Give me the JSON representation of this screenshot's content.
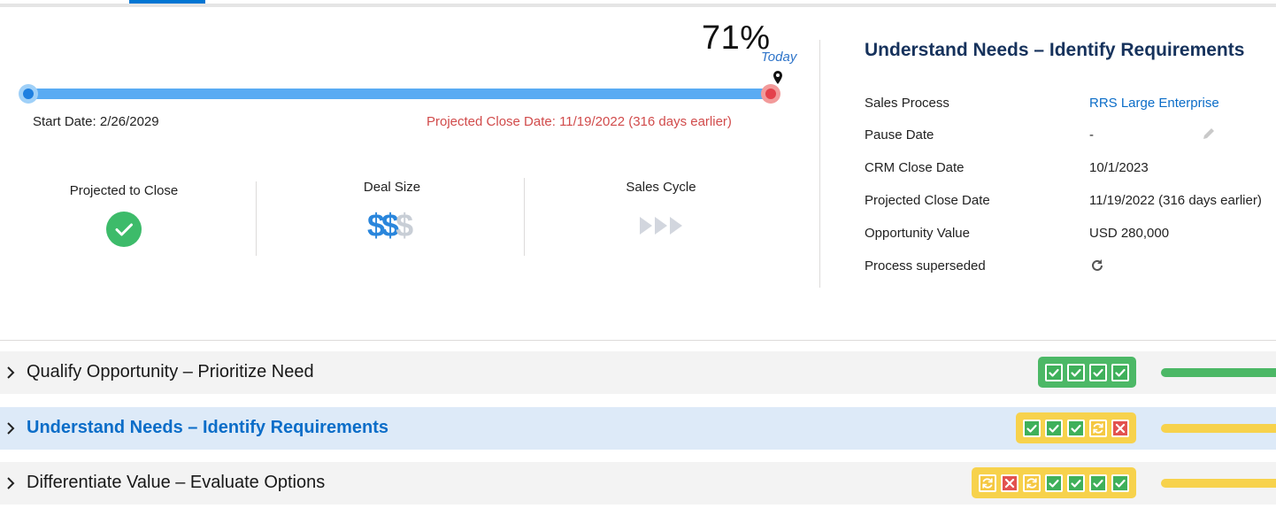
{
  "progress": {
    "percent": "71%",
    "percent_value": 71,
    "today_label": "Today",
    "start_date": "Start Date: 2/26/2029",
    "projected_close": "Projected Close Date: 11/19/2022 (316 days earlier)"
  },
  "metrics": [
    {
      "label": "Projected to Close",
      "icon": "check-circle-icon",
      "color": "#3dbb6a"
    },
    {
      "label": "Deal Size",
      "icon": "dollar-signs-icon",
      "filled": 2,
      "total": 3
    },
    {
      "label": "Sales Cycle",
      "icon": "chevrons-icon",
      "filled": 0,
      "total": 3
    }
  ],
  "details": {
    "title": "Understand Needs – Identify Requirements",
    "rows": [
      {
        "label": "Sales Process",
        "value": "RRS Large Enterprise"
      },
      {
        "label": "Pause Date",
        "value": "-"
      },
      {
        "label": "CRM Close Date",
        "value": "10/1/2023"
      },
      {
        "label": "Projected Close Date",
        "value": "11/19/2022 (316 days earlier)"
      },
      {
        "label": "Opportunity Value",
        "value": "USD 280,000"
      },
      {
        "label": "Process superseded",
        "value": ""
      }
    ]
  },
  "stages": [
    {
      "title": "Qualify Opportunity – Prioritize Need",
      "status_color": "#4cb866",
      "tasks": [
        "done",
        "done",
        "done",
        "done"
      ]
    },
    {
      "title": "Understand Needs – Identify Requirements",
      "status_color": "#f7d24c",
      "tasks": [
        "done",
        "done",
        "done",
        "wait",
        "stop"
      ]
    },
    {
      "title": "Differentiate Value – Evaluate Options",
      "status_color": "#f7d24c",
      "tasks": [
        "wait",
        "stop",
        "wait",
        "done",
        "done",
        "done",
        "done"
      ]
    }
  ],
  "colors": {
    "accent": "#0176d3",
    "danger": "#d14b4b",
    "success": "#4cb866",
    "warning": "#f7d24c"
  }
}
